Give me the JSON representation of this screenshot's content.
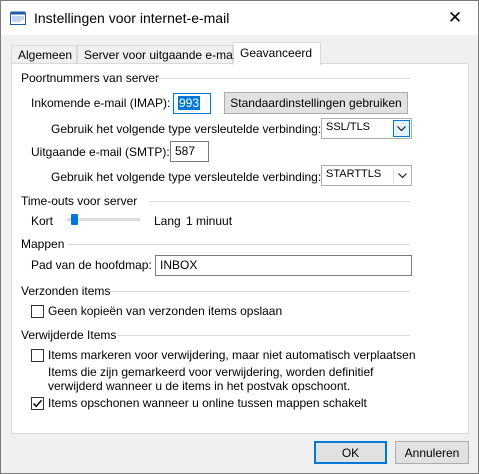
{
  "window": {
    "title": "Instellingen voor internet-e-mail",
    "close_glyph": "✕"
  },
  "tabs": [
    {
      "label": "Algemeen",
      "active": false
    },
    {
      "label": "Server voor uitgaande e-mail",
      "active": false
    },
    {
      "label": "Geavanceerd",
      "active": true
    }
  ],
  "ports": {
    "heading": "Poortnummers van server",
    "incoming_label": "Inkomende e-mail (IMAP):",
    "incoming_value": "993",
    "defaults_button": "Standaardinstellingen gebruiken",
    "incoming_enc_label": "Gebruik het volgende type versleutelde verbinding:",
    "incoming_enc_value": "SSL/TLS",
    "outgoing_label": "Uitgaande e-mail (SMTP):",
    "outgoing_value": "587",
    "outgoing_enc_label": "Gebruik het volgende type versleutelde verbinding:",
    "outgoing_enc_value": "STARTTLS"
  },
  "timeouts": {
    "heading": "Time-outs voor server",
    "short_label": "Kort",
    "long_label": "Lang",
    "value_label": "1 minuut",
    "slider_level": 0.05
  },
  "folders": {
    "heading": "Mappen",
    "root_label": "Pad van de hoofdmap:",
    "root_value": "INBOX"
  },
  "sent": {
    "heading": "Verzonden items",
    "no_copies_label": "Geen kopieën van verzonden items opslaan",
    "no_copies_checked": false
  },
  "deleted": {
    "heading": "Verwijderde Items",
    "mark_label": "Items markeren voor verwijdering, maar niet automatisch verplaatsen",
    "mark_checked": false,
    "mark_note_line1": "Items die zijn gemarkeerd voor verwijdering, worden definitief",
    "mark_note_line2": "verwijderd wanneer u de items in het postvak opschoont.",
    "purge_label": "Items opschonen wanneer u online tussen mappen schakelt",
    "purge_checked": true
  },
  "footer": {
    "ok_label": "OK",
    "cancel_label": "Annuleren"
  },
  "icons": [
    "mail-settings-icon",
    "close-icon",
    "dropdown-arrow-icon",
    "checkmark-icon"
  ],
  "colors": {
    "accent": "#0078d7",
    "panel": "#ffffff",
    "chrome": "#f0f0f0"
  }
}
